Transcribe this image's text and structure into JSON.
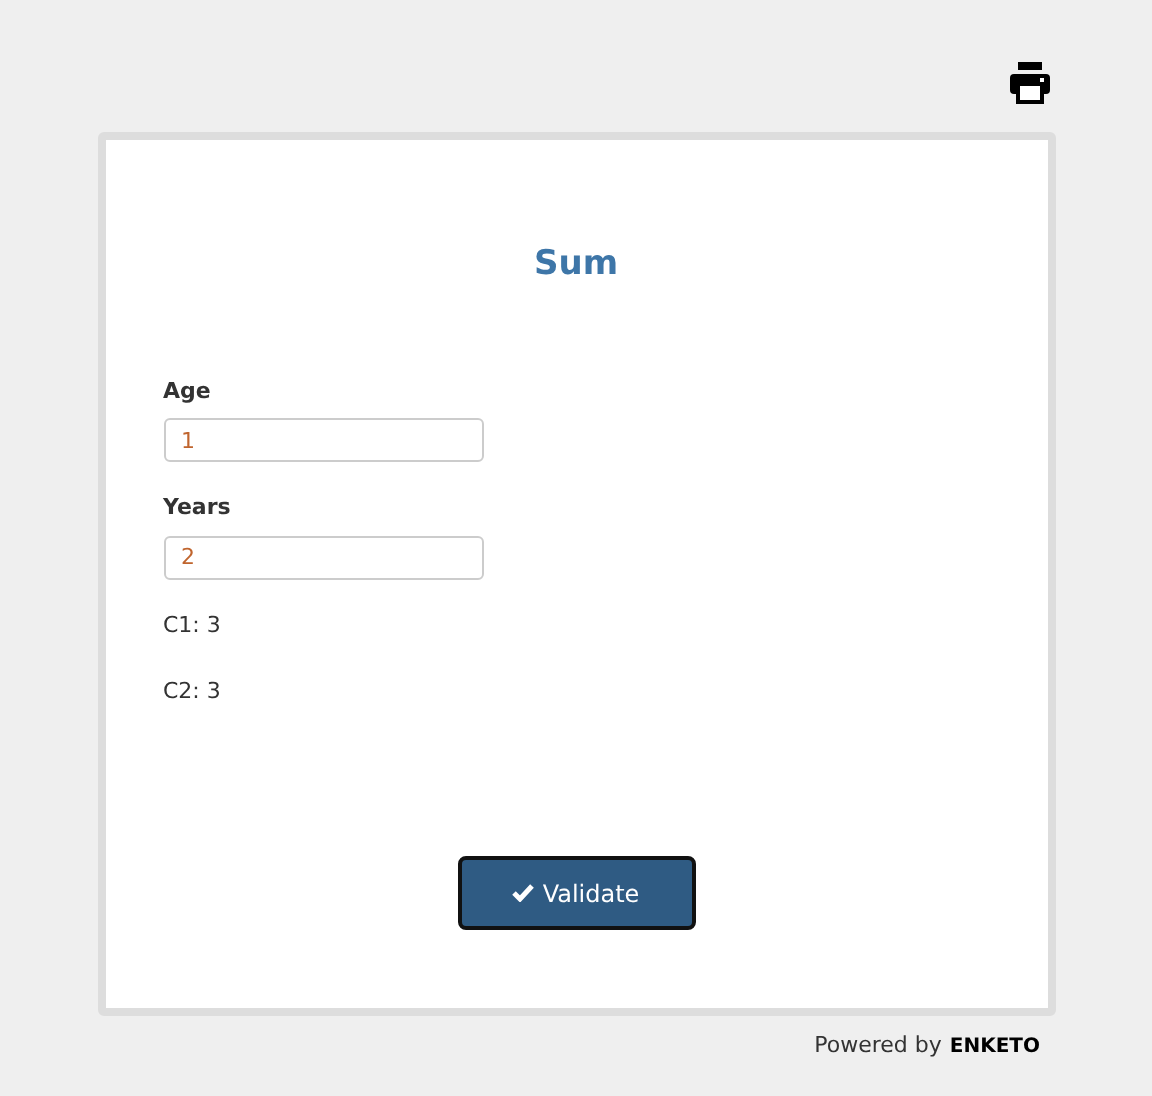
{
  "form": {
    "title": "Sum",
    "questions": [
      {
        "label": "Age",
        "value": "1"
      },
      {
        "label": "Years",
        "value": "2"
      }
    ],
    "notes": [
      "C1: 3",
      "C2: 3"
    ],
    "submit_button": "Validate"
  },
  "footer": {
    "text": "Powered by",
    "brand": "ENKETO"
  }
}
